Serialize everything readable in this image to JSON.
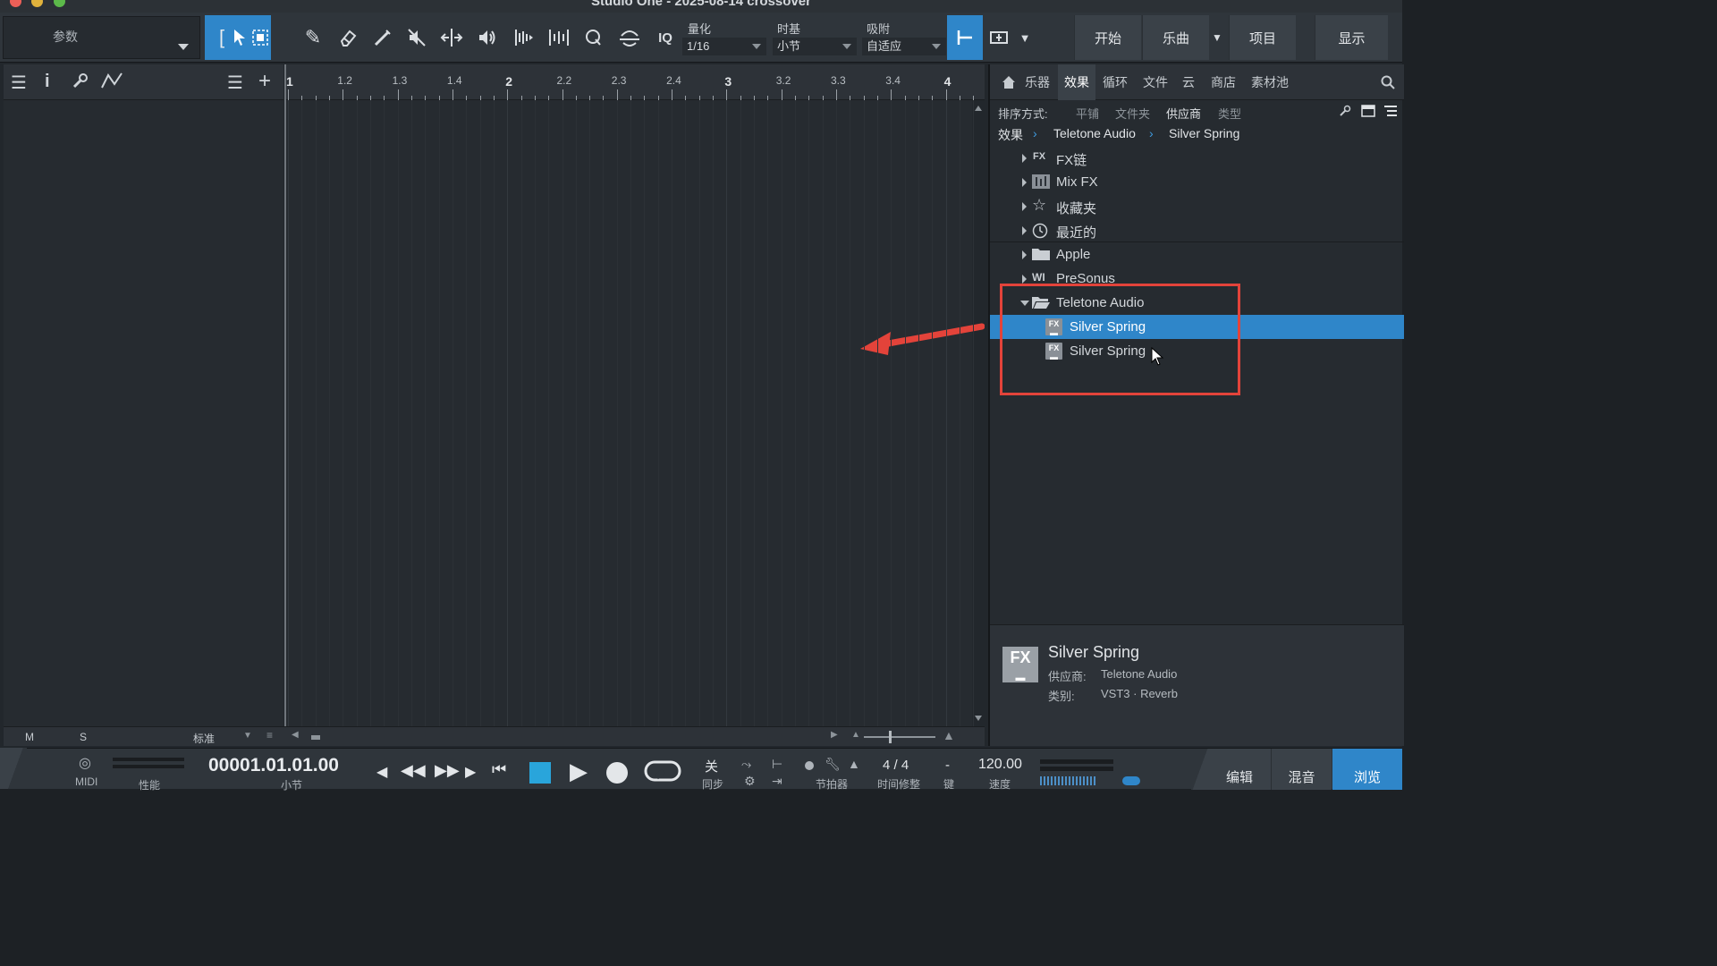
{
  "window": {
    "title": "Studio One - 2025-08-14 crossover"
  },
  "toolbar": {
    "param_label": "参数",
    "quantize_label": "量化",
    "quantize_value": "1/16",
    "timebase_label": "时基",
    "timebase_value": "小节",
    "snap_label": "吸附",
    "snap_value": "自适应",
    "iq_label": "IQ",
    "nav": [
      "开始",
      "乐曲",
      "项目",
      "显示"
    ]
  },
  "ruler": {
    "ticks": [
      "1",
      "1.2",
      "1.3",
      "1.4",
      "2",
      "2.2",
      "2.3",
      "2.4",
      "3",
      "3.2",
      "3.3",
      "3.4",
      "4"
    ]
  },
  "browser": {
    "tabs": [
      "乐器",
      "效果",
      "循环",
      "文件",
      "云",
      "商店",
      "素材池"
    ],
    "active_tab": "效果",
    "sort_label": "排序方式:",
    "sort_options": [
      "平铺",
      "文件夹",
      "供应商",
      "类型"
    ],
    "active_sort": "供应商",
    "breadcrumb": [
      "效果",
      "Teletone Audio",
      "Silver Spring"
    ],
    "tree": [
      {
        "label": "FX链",
        "icon": "fx-chain-icon"
      },
      {
        "label": "Mix FX",
        "icon": "mixfx-icon"
      },
      {
        "label": "收藏夹",
        "icon": "star-icon"
      },
      {
        "label": "最近的",
        "icon": "clock-icon"
      },
      {
        "label": "Apple",
        "icon": "folder-icon"
      },
      {
        "label": "PreSonus",
        "icon": "presonus-icon"
      },
      {
        "label": "Teletone Audio",
        "icon": "folder-open-icon"
      }
    ],
    "plugins": [
      {
        "name": "Silver Spring",
        "selected": true
      },
      {
        "name": "Silver Spring",
        "selected": false
      }
    ],
    "info": {
      "name": "Silver Spring",
      "vendor_label": "供应商:",
      "vendor": "Teletone Audio",
      "category_label": "类别:",
      "category": "VST3 · Reverb",
      "fx_badge": "FX"
    }
  },
  "bottom_strip": {
    "m": "M",
    "s": "S",
    "mode": "标准"
  },
  "transport": {
    "midi": "MIDI",
    "perf": "性能",
    "time": "00001.01.01.00",
    "time_unit": "小节",
    "sync_value": "关",
    "sync_label": "同步",
    "metronome_label": "节拍器",
    "signature": "4 / 4",
    "signature_label": "时间修整",
    "key_value": "-",
    "key_label": "键",
    "tempo": "120.00",
    "tempo_label": "速度",
    "pages": [
      "编辑",
      "混音",
      "浏览"
    ],
    "active_page": "浏览"
  },
  "colors": {
    "accent": "#2f86c9",
    "annotation": "#e3433a"
  }
}
